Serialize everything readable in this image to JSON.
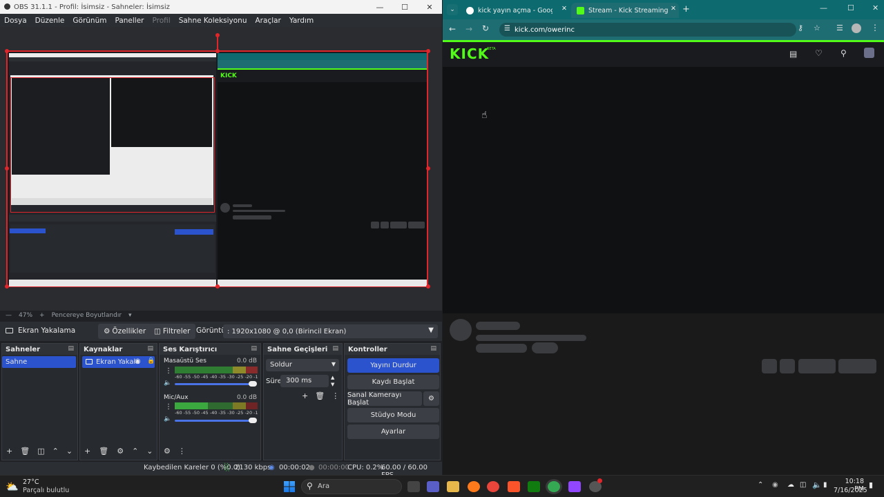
{
  "obs": {
    "title": "OBS 31.1.1 - Profil: İsimsiz - Sahneler: İsimsiz",
    "menu": [
      "Dosya",
      "Düzenle",
      "Görünüm",
      "Paneller",
      "Profil",
      "Sahne Koleksiyonu",
      "Araçlar",
      "Yardım"
    ],
    "zoom": "47%",
    "zoom_fit": "Pencereye Boyutlandır",
    "source_toolbar": {
      "source_name": "Ekran Yakalama",
      "properties": "Özellikler",
      "filters": "Filtreler",
      "display_label": "Görüntü",
      "display_value": ": 1920x1080 @ 0,0 (Birincil Ekran)"
    },
    "docks": {
      "scenes": {
        "title": "Sahneler",
        "items": [
          "Sahne"
        ]
      },
      "sources": {
        "title": "Kaynaklar",
        "items": [
          "Ekran Yakala"
        ]
      },
      "mixer": {
        "title": "Ses Karıştırıcı",
        "channels": [
          {
            "name": "Masaüstü Ses",
            "db": "0.0 dB"
          },
          {
            "name": "Mic/Aux",
            "db": "0.0 dB"
          }
        ],
        "scale": "-60 -55 -50 -45 -40 -35 -30 -25 -20 -15 -10 -5 0"
      },
      "transitions": {
        "title": "Sahne Geçişleri",
        "type": "Soldur",
        "duration_label": "Süre",
        "duration": "300 ms"
      },
      "controls": {
        "title": "Kontroller",
        "buttons": [
          "Yayını Durdur",
          "Kaydı Başlat",
          "Sanal Kamerayı Başlat",
          "Stüdyo Modu",
          "Ayarlar"
        ]
      }
    },
    "status": {
      "dropped": "Kaybedilen Kareler 0 (%0.0)",
      "bitrate": "2130 kbps",
      "stream_time": "00:00:02",
      "rec_time": "00:00:00",
      "cpu": "CPU: 0.2%",
      "fps": "60.00 / 60.00 FPS"
    },
    "colors": {
      "accent": "#2a53cd",
      "selection": "#e0262a"
    }
  },
  "chrome": {
    "tabs": [
      {
        "title": "kick yayın açma - Google'da Ar"
      },
      {
        "title": "Stream - Kick Streaming"
      }
    ],
    "url": "kick.com/owerinc",
    "kick_logo": "KICK",
    "kick_beta": "BETA",
    "colors": {
      "tab_strip": "#0d6b6f",
      "kick_green": "#53fc18"
    }
  },
  "taskbar": {
    "weather_temp": "27°C",
    "weather_desc": "Parçalı bulutlu",
    "search_placeholder": "Ara",
    "time": "10:18 PM",
    "date": "7/16/2025"
  }
}
